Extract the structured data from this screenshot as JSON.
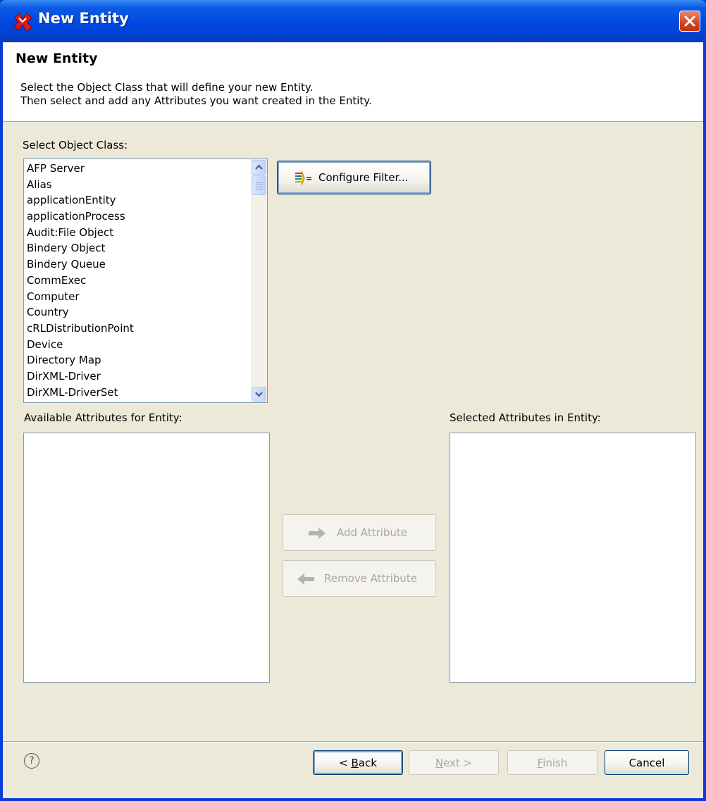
{
  "window": {
    "title": "New Entity",
    "app_icon": "novell-designer-icon",
    "close_icon": "close-icon"
  },
  "header": {
    "title": "New Entity",
    "desc_line1": "Select the Object Class that will define your new Entity.",
    "desc_line2": "Then select and add any Attributes you want created in the Entity."
  },
  "object_class": {
    "label": "Select Object Class:",
    "items": [
      "AFP Server",
      "Alias",
      "applicationEntity",
      "applicationProcess",
      "Audit:File Object",
      "Bindery Object",
      "Bindery Queue",
      "CommExec",
      "Computer",
      "Country",
      "cRLDistributionPoint",
      "Device",
      "Directory Map",
      "DirXML-Driver",
      "DirXML-DriverSet"
    ]
  },
  "configure_filter": {
    "label": "Configure Filter...",
    "icon": "filter-icon"
  },
  "available": {
    "label": "Available Attributes for Entity:",
    "items": []
  },
  "selected": {
    "label": "Selected Attributes in Entity:",
    "items": []
  },
  "add_attribute": {
    "label": "Add Attribute",
    "icon": "arrow-right-icon",
    "enabled": false
  },
  "remove_attribute": {
    "label": "Remove Attribute",
    "icon": "arrow-left-icon",
    "enabled": false
  },
  "footer": {
    "help_icon": "help-icon",
    "help_glyph": "?",
    "back": {
      "prefix": "< ",
      "mnemonic": "B",
      "suffix": "ack"
    },
    "next": {
      "mnemonic": "N",
      "suffix": "ext >"
    },
    "finish": {
      "mnemonic": "F",
      "suffix": "inish"
    },
    "cancel": "Cancel"
  },
  "colors": {
    "titlebar": "#0054e3",
    "dialog_bg": "#ece9d8",
    "list_border": "#7f9db9"
  }
}
